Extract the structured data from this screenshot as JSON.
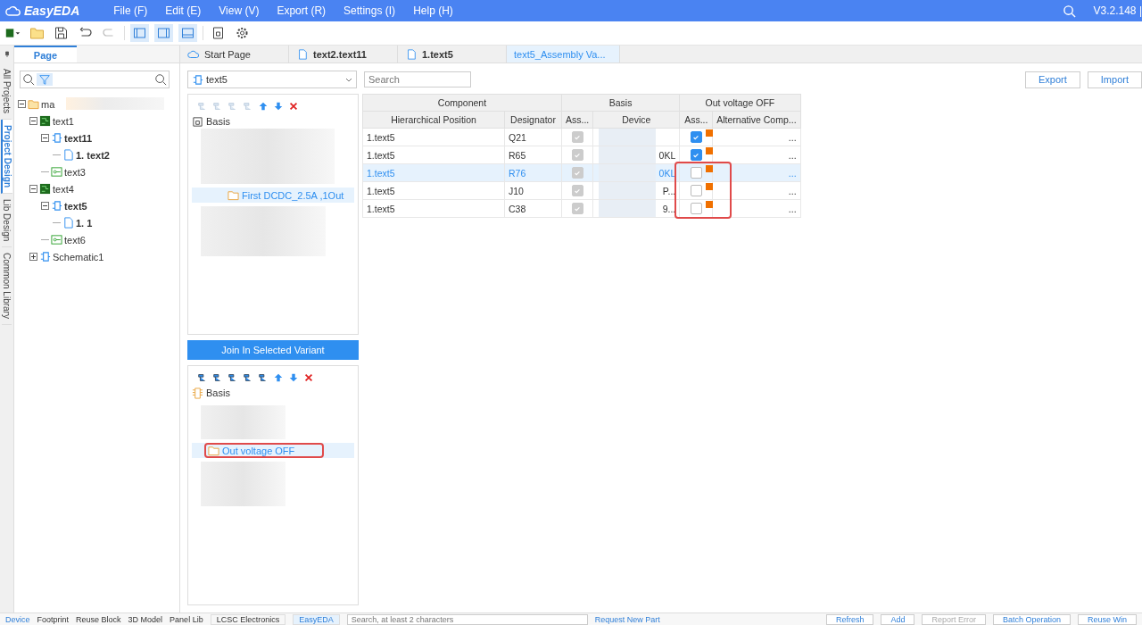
{
  "app": {
    "logo": "EasyEDA",
    "menu": [
      "File (F)",
      "Edit (E)",
      "View (V)",
      "Export (R)",
      "Settings (I)",
      "Help (H)"
    ],
    "version": "V3.2.148 |"
  },
  "side_tabs": [
    {
      "label": "All Projects",
      "selected": false
    },
    {
      "label": "Project Design",
      "selected": true
    },
    {
      "label": "Lib Design",
      "selected": false
    },
    {
      "label": "Common Library",
      "selected": false
    }
  ],
  "panel_tabs": [
    {
      "label": "Page",
      "selected": true
    }
  ],
  "tree": [
    {
      "label": "ma",
      "kind": "folder",
      "expanded": true,
      "bold": false,
      "children": [
        {
          "label": "text1",
          "kind": "board",
          "expanded": true,
          "bold": false,
          "children": [
            {
              "label": "text11",
              "kind": "schematic",
              "expanded": true,
              "bold": true,
              "children": [
                {
                  "label": "1. text2",
                  "kind": "page",
                  "bold": true
                }
              ]
            },
            {
              "label": "text3",
              "kind": "pcb",
              "bold": false
            }
          ]
        },
        {
          "label": "text4",
          "kind": "board",
          "expanded": true,
          "bold": false,
          "children": [
            {
              "label": "text5",
              "kind": "schematic",
              "expanded": true,
              "bold": true,
              "children": [
                {
                  "label": "1. 1",
                  "kind": "page",
                  "bold": true
                }
              ]
            },
            {
              "label": "text6",
              "kind": "pcb",
              "bold": false
            }
          ]
        },
        {
          "label": "Schematic1",
          "kind": "schematic",
          "expanded": false,
          "bold": false
        }
      ]
    }
  ],
  "doc_tabs": [
    {
      "label": "Start Page",
      "kind": "start",
      "bold": false,
      "selected": false
    },
    {
      "label": "text2.text11",
      "kind": "doc",
      "bold": true,
      "selected": false
    },
    {
      "label": "1.text5",
      "kind": "doc",
      "bold": true,
      "selected": false
    },
    {
      "label": "text5_Assembly Va...",
      "kind": "plain",
      "bold": false,
      "selected": true
    }
  ],
  "variant_select": {
    "value": "text5"
  },
  "search": {
    "placeholder": "Search"
  },
  "buttons": [
    "Export",
    "Import"
  ],
  "upper_tree": {
    "root": "Basis",
    "selected_item": "First DCDC_2.5A ,1Out"
  },
  "join_button": "Join In Selected Variant",
  "lower_tree": {
    "root": "Basis",
    "selected_item": "Out voltage OFF"
  },
  "table": {
    "groups": [
      "Component",
      "Basis",
      "Out voltage OFF"
    ],
    "columns": [
      "Hierarchical Position",
      "Designator",
      "Ass...",
      "Device",
      "Ass...",
      "Alternative Comp..."
    ],
    "rows": [
      {
        "position": "1.text5",
        "designator": "Q21",
        "basis_checked": true,
        "variant_checked": true,
        "flagged": true,
        "more": "...",
        "selected": false
      },
      {
        "position": "1.text5",
        "designator": "R65",
        "basis_checked": true,
        "device": "0KL",
        "variant_checked": true,
        "flagged": true,
        "more": "...",
        "selected": false
      },
      {
        "position": "1.text5",
        "designator": "R76",
        "basis_checked": true,
        "device": "0KL",
        "variant_checked": false,
        "flagged": true,
        "more": "...",
        "selected": true
      },
      {
        "position": "1.text5",
        "designator": "J10",
        "basis_checked": true,
        "device": "P...",
        "variant_checked": false,
        "flagged": true,
        "more": "...",
        "selected": false
      },
      {
        "position": "1.text5",
        "designator": "C38",
        "basis_checked": true,
        "device": "9...",
        "variant_checked": false,
        "flagged": true,
        "more": "...",
        "selected": false
      }
    ]
  },
  "bottom_tabs": [
    {
      "label": "Device",
      "selected": true
    },
    {
      "label": "Footprint",
      "selected": false
    },
    {
      "label": "Reuse Block",
      "selected": false
    },
    {
      "label": "3D Model",
      "selected": false
    },
    {
      "label": "Panel Lib",
      "selected": false
    }
  ],
  "source_tabs": [
    {
      "label": "LCSC Electronics",
      "selected": false
    },
    {
      "label": "EasyEDA",
      "selected": true
    }
  ],
  "lib_search": {
    "placeholder": "Search, at least 2 characters"
  },
  "request_link": "Request New Part",
  "bottom_buttons": [
    {
      "label": "Refresh",
      "disabled": false
    },
    {
      "label": "Add",
      "disabled": false
    },
    {
      "label": "Report Error",
      "disabled": true
    },
    {
      "label": "Batch Operation",
      "disabled": false
    },
    {
      "label": "Reuse Win",
      "disabled": false
    }
  ]
}
